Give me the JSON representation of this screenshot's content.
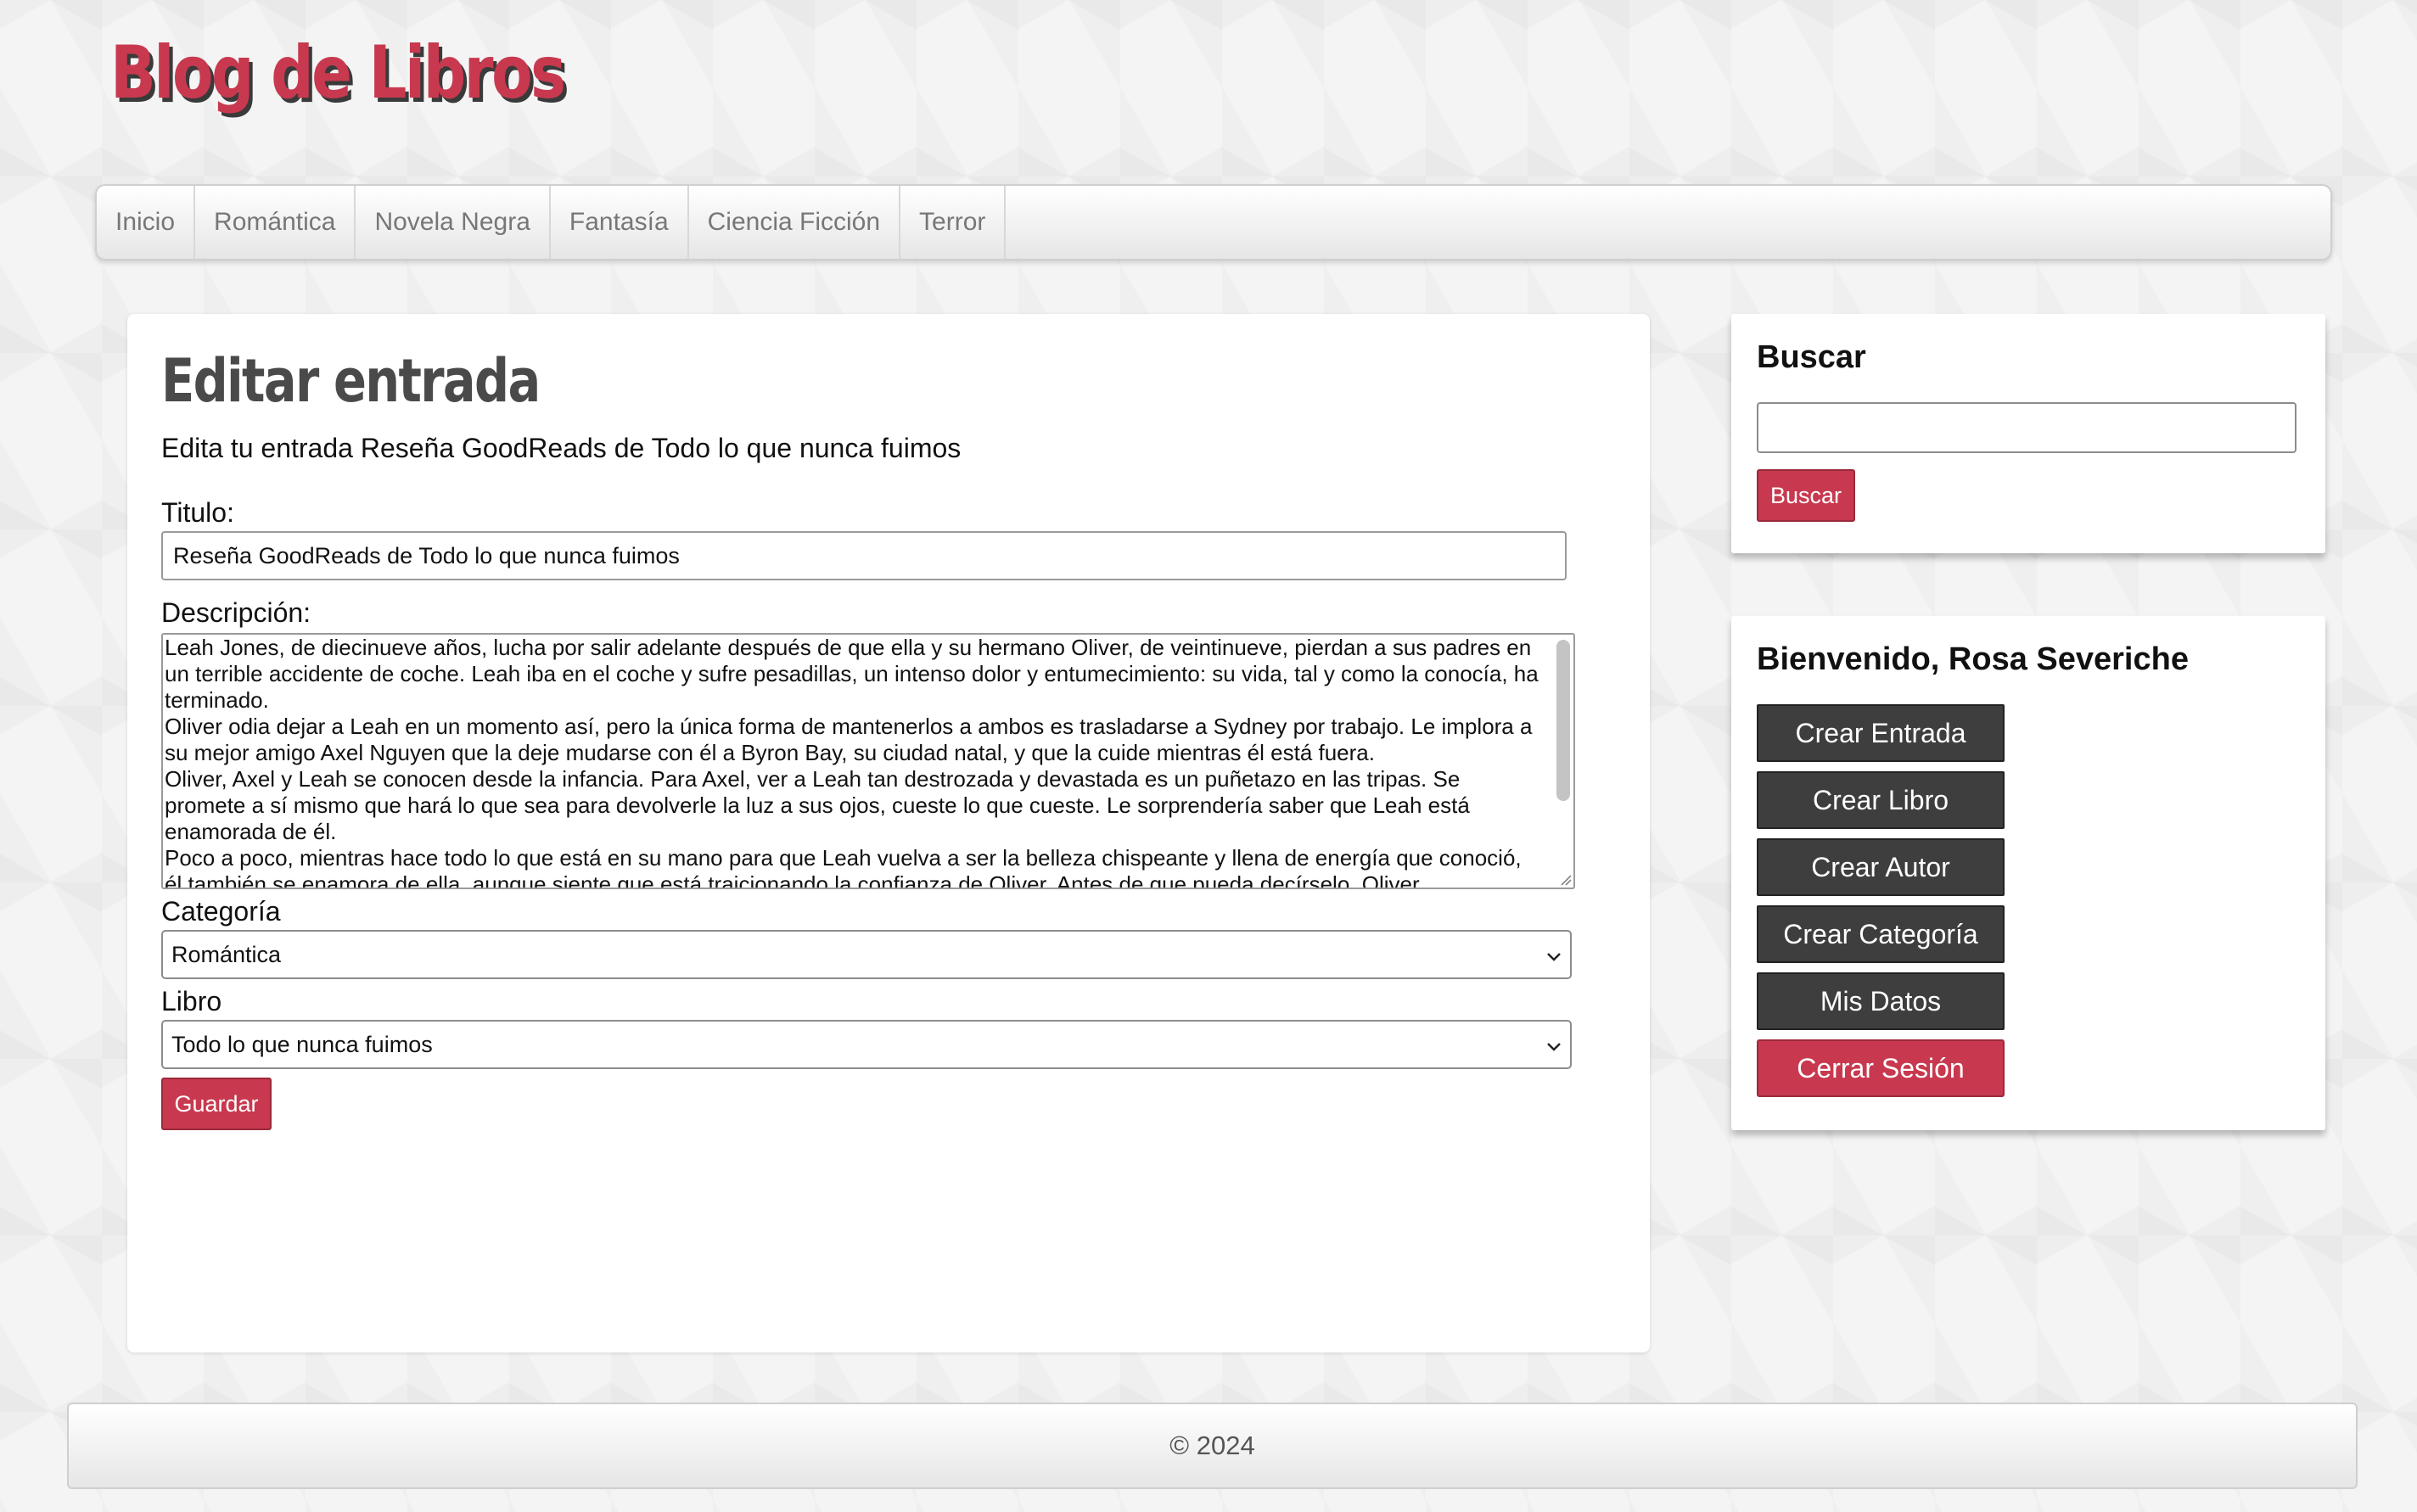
{
  "site": {
    "title": "Blog de Libros"
  },
  "nav": {
    "items": [
      "Inicio",
      "Romántica",
      "Novela Negra",
      "Fantasía",
      "Ciencia Ficción",
      "Terror"
    ]
  },
  "editor": {
    "heading": "Editar entrada",
    "subtitle": "Edita tu entrada Reseña GoodReads de Todo lo que nunca fuimos",
    "title_label": "Titulo:",
    "title_value": "Reseña GoodReads de Todo lo que nunca fuimos",
    "description_label": "Descripción:",
    "description_paragraphs": [
      "Leah Jones, de diecinueve años, lucha por salir adelante después de que ella y su hermano Oliver, de veintinueve, pierdan a sus padres en un terrible accidente de coche. Leah iba en el coche y sufre pesadillas, un intenso dolor y entumecimiento: su vida, tal y como la conocía, ha terminado.",
      "Oliver odia dejar a Leah en un momento así, pero la única forma de mantenerlos a ambos es trasladarse a Sydney por trabajo. Le implora a su mejor amigo Axel Nguyen que la deje mudarse con él a Byron Bay, su ciudad natal, y que la cuide mientras él está fuera.",
      "Oliver, Axel y Leah se conocen desde la infancia. Para Axel, ver a Leah tan destrozada y devastada es un puñetazo en las tripas. Se promete a sí mismo que hará lo que sea para devolverle la luz a sus ojos, cueste lo que cueste. Le sorprendería saber que Leah está enamorada de él.",
      "Poco a poco, mientras hace todo lo que está en su mano para que Leah vuelva a ser la belleza chispeante y llena de energía que conoció, él también se enamora de ella, aunque siente que está traicionando la confianza de Oliver. Antes de que pueda decírselo, Oliver"
    ],
    "category_label": "Categoría",
    "category_value": "Romántica",
    "book_label": "Libro",
    "book_value": "Todo lo que nunca fuimos",
    "save_label": "Guardar"
  },
  "search": {
    "title": "Buscar",
    "value": "",
    "button_label": "Buscar"
  },
  "user_panel": {
    "welcome": "Bienvenido, Rosa Severiche",
    "buttons": [
      "Crear Entrada",
      "Crear Libro",
      "Crear Autor",
      "Crear Categoría",
      "Mis Datos"
    ],
    "logout_label": "Cerrar Sesión"
  },
  "footer": {
    "text": "© 2024"
  },
  "colors": {
    "accent": "#c8394f",
    "dark_button": "#3e3e3e",
    "heading_gray": "#4a4a4a"
  }
}
